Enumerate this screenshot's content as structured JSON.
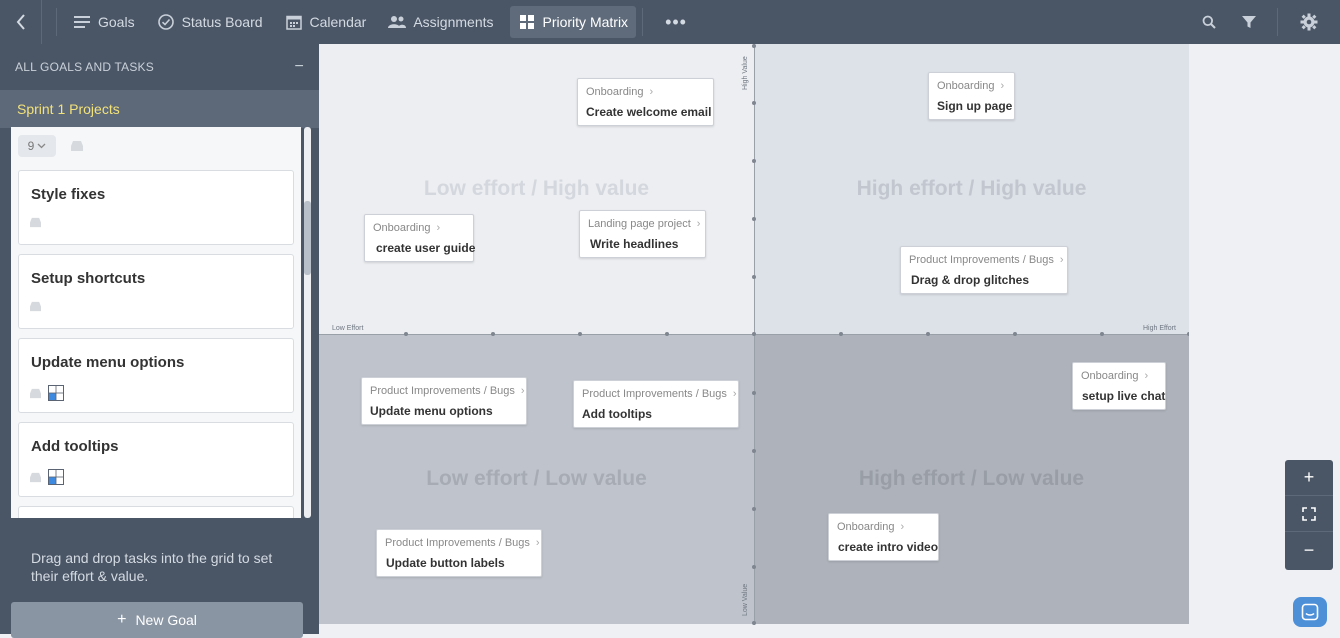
{
  "nav": {
    "items": [
      {
        "label": "Goals",
        "icon": "lines-icon"
      },
      {
        "label": "Status Board",
        "icon": "check-circle-icon"
      },
      {
        "label": "Calendar",
        "icon": "calendar-icon"
      },
      {
        "label": "Assignments",
        "icon": "people-icon"
      },
      {
        "label": "Priority Matrix",
        "icon": "grid-icon",
        "active": true
      }
    ],
    "more": "•••"
  },
  "sidebar": {
    "header": "ALL GOALS AND TASKS",
    "collapse": "−",
    "project": "Sprint 1 Projects",
    "count": "9",
    "tasks": [
      {
        "title": "Style fixes"
      },
      {
        "title": "Setup shortcuts"
      },
      {
        "title": "Update menu options"
      },
      {
        "title": "Add tooltips"
      }
    ],
    "hint": "Drag and drop tasks into the grid to set their effort & value.",
    "new_goal": "New Goal"
  },
  "matrix": {
    "quadrants": {
      "q1": "Low effort / High value",
      "q2": "High effort / High value",
      "q3": "Low effort / Low value",
      "q4": "High effort / Low value"
    },
    "axes": {
      "low_effort": "Low Effort",
      "high_effort": "High Effort",
      "high_value": "High Value",
      "low_value": "Low Value"
    },
    "cards": [
      {
        "category": "Onboarding",
        "name": "Create welcome email"
      },
      {
        "category": "Onboarding",
        "name": "Sign up page"
      },
      {
        "category": "Onboarding",
        "name": "create user guide"
      },
      {
        "category": "Landing page project",
        "name": "Write headlines"
      },
      {
        "category": "Product Improvements / Bugs",
        "name": "Drag & drop glitches"
      },
      {
        "category": "Product Improvements / Bugs",
        "name": "Update menu options"
      },
      {
        "category": "Product Improvements / Bugs",
        "name": "Add tooltips"
      },
      {
        "category": "Onboarding",
        "name": "setup live chat"
      },
      {
        "category": "Product Improvements / Bugs",
        "name": "Update button labels"
      },
      {
        "category": "Onboarding",
        "name": "create intro video"
      }
    ]
  },
  "zoom": {
    "plus": "+",
    "fit": "⛶",
    "minus": "−"
  },
  "colors": {
    "topbar": "#4a5666",
    "project_text": "#f2e27a",
    "accent_blue": "#4d90d8"
  }
}
